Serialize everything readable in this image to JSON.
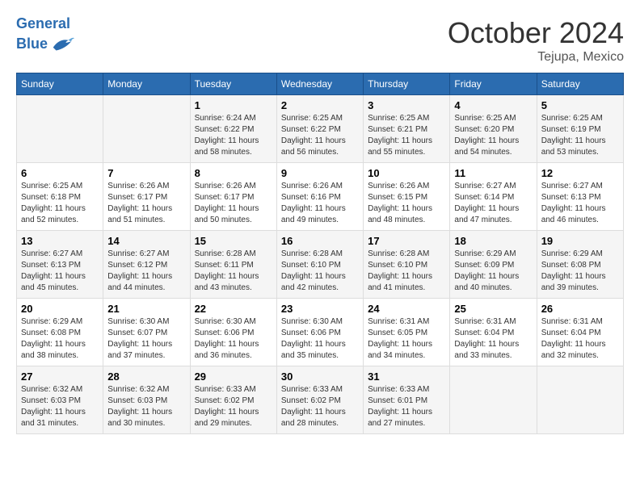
{
  "header": {
    "logo_line1": "General",
    "logo_line2": "Blue",
    "month": "October 2024",
    "location": "Tejupa, Mexico"
  },
  "weekdays": [
    "Sunday",
    "Monday",
    "Tuesday",
    "Wednesday",
    "Thursday",
    "Friday",
    "Saturday"
  ],
  "rows": [
    [
      {
        "day": "",
        "info": ""
      },
      {
        "day": "",
        "info": ""
      },
      {
        "day": "1",
        "info": "Sunrise: 6:24 AM\nSunset: 6:22 PM\nDaylight: 11 hours and 58 minutes."
      },
      {
        "day": "2",
        "info": "Sunrise: 6:25 AM\nSunset: 6:22 PM\nDaylight: 11 hours and 56 minutes."
      },
      {
        "day": "3",
        "info": "Sunrise: 6:25 AM\nSunset: 6:21 PM\nDaylight: 11 hours and 55 minutes."
      },
      {
        "day": "4",
        "info": "Sunrise: 6:25 AM\nSunset: 6:20 PM\nDaylight: 11 hours and 54 minutes."
      },
      {
        "day": "5",
        "info": "Sunrise: 6:25 AM\nSunset: 6:19 PM\nDaylight: 11 hours and 53 minutes."
      }
    ],
    [
      {
        "day": "6",
        "info": "Sunrise: 6:25 AM\nSunset: 6:18 PM\nDaylight: 11 hours and 52 minutes."
      },
      {
        "day": "7",
        "info": "Sunrise: 6:26 AM\nSunset: 6:17 PM\nDaylight: 11 hours and 51 minutes."
      },
      {
        "day": "8",
        "info": "Sunrise: 6:26 AM\nSunset: 6:17 PM\nDaylight: 11 hours and 50 minutes."
      },
      {
        "day": "9",
        "info": "Sunrise: 6:26 AM\nSunset: 6:16 PM\nDaylight: 11 hours and 49 minutes."
      },
      {
        "day": "10",
        "info": "Sunrise: 6:26 AM\nSunset: 6:15 PM\nDaylight: 11 hours and 48 minutes."
      },
      {
        "day": "11",
        "info": "Sunrise: 6:27 AM\nSunset: 6:14 PM\nDaylight: 11 hours and 47 minutes."
      },
      {
        "day": "12",
        "info": "Sunrise: 6:27 AM\nSunset: 6:13 PM\nDaylight: 11 hours and 46 minutes."
      }
    ],
    [
      {
        "day": "13",
        "info": "Sunrise: 6:27 AM\nSunset: 6:13 PM\nDaylight: 11 hours and 45 minutes."
      },
      {
        "day": "14",
        "info": "Sunrise: 6:27 AM\nSunset: 6:12 PM\nDaylight: 11 hours and 44 minutes."
      },
      {
        "day": "15",
        "info": "Sunrise: 6:28 AM\nSunset: 6:11 PM\nDaylight: 11 hours and 43 minutes."
      },
      {
        "day": "16",
        "info": "Sunrise: 6:28 AM\nSunset: 6:10 PM\nDaylight: 11 hours and 42 minutes."
      },
      {
        "day": "17",
        "info": "Sunrise: 6:28 AM\nSunset: 6:10 PM\nDaylight: 11 hours and 41 minutes."
      },
      {
        "day": "18",
        "info": "Sunrise: 6:29 AM\nSunset: 6:09 PM\nDaylight: 11 hours and 40 minutes."
      },
      {
        "day": "19",
        "info": "Sunrise: 6:29 AM\nSunset: 6:08 PM\nDaylight: 11 hours and 39 minutes."
      }
    ],
    [
      {
        "day": "20",
        "info": "Sunrise: 6:29 AM\nSunset: 6:08 PM\nDaylight: 11 hours and 38 minutes."
      },
      {
        "day": "21",
        "info": "Sunrise: 6:30 AM\nSunset: 6:07 PM\nDaylight: 11 hours and 37 minutes."
      },
      {
        "day": "22",
        "info": "Sunrise: 6:30 AM\nSunset: 6:06 PM\nDaylight: 11 hours and 36 minutes."
      },
      {
        "day": "23",
        "info": "Sunrise: 6:30 AM\nSunset: 6:06 PM\nDaylight: 11 hours and 35 minutes."
      },
      {
        "day": "24",
        "info": "Sunrise: 6:31 AM\nSunset: 6:05 PM\nDaylight: 11 hours and 34 minutes."
      },
      {
        "day": "25",
        "info": "Sunrise: 6:31 AM\nSunset: 6:04 PM\nDaylight: 11 hours and 33 minutes."
      },
      {
        "day": "26",
        "info": "Sunrise: 6:31 AM\nSunset: 6:04 PM\nDaylight: 11 hours and 32 minutes."
      }
    ],
    [
      {
        "day": "27",
        "info": "Sunrise: 6:32 AM\nSunset: 6:03 PM\nDaylight: 11 hours and 31 minutes."
      },
      {
        "day": "28",
        "info": "Sunrise: 6:32 AM\nSunset: 6:03 PM\nDaylight: 11 hours and 30 minutes."
      },
      {
        "day": "29",
        "info": "Sunrise: 6:33 AM\nSunset: 6:02 PM\nDaylight: 11 hours and 29 minutes."
      },
      {
        "day": "30",
        "info": "Sunrise: 6:33 AM\nSunset: 6:02 PM\nDaylight: 11 hours and 28 minutes."
      },
      {
        "day": "31",
        "info": "Sunrise: 6:33 AM\nSunset: 6:01 PM\nDaylight: 11 hours and 27 minutes."
      },
      {
        "day": "",
        "info": ""
      },
      {
        "day": "",
        "info": ""
      }
    ]
  ]
}
